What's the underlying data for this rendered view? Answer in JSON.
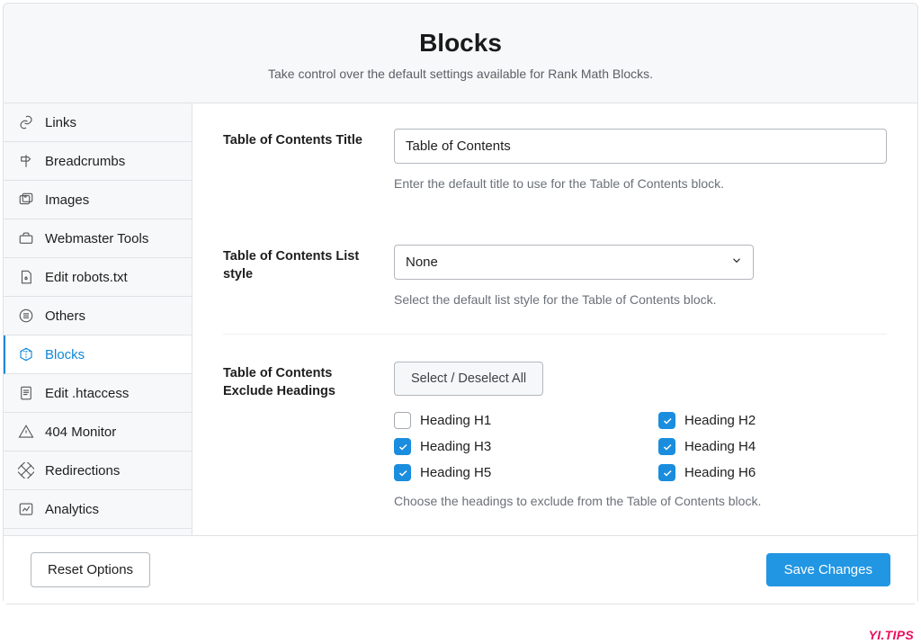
{
  "header": {
    "title": "Blocks",
    "subtitle": "Take control over the default settings available for Rank Math Blocks."
  },
  "sidebar": [
    {
      "label": "Links"
    },
    {
      "label": "Breadcrumbs"
    },
    {
      "label": "Images"
    },
    {
      "label": "Webmaster Tools"
    },
    {
      "label": "Edit robots.txt"
    },
    {
      "label": "Others"
    },
    {
      "label": "Blocks",
      "active": true
    },
    {
      "label": "Edit .htaccess"
    },
    {
      "label": "404 Monitor"
    },
    {
      "label": "Redirections"
    },
    {
      "label": "Analytics"
    }
  ],
  "settings": {
    "toc_title": {
      "label": "Table of Contents Title",
      "value": "Table of Contents",
      "help": "Enter the default title to use for the Table of Contents block."
    },
    "toc_list_style": {
      "label": "Table of Contents List style",
      "value": "None",
      "help": "Select the default list style for the Table of Contents block."
    },
    "toc_exclude": {
      "label": "Table of Contents Exclude Headings",
      "toggle_all": "Select / Deselect All",
      "options": [
        {
          "label": "Heading H1",
          "checked": false
        },
        {
          "label": "Heading H2",
          "checked": true
        },
        {
          "label": "Heading H3",
          "checked": true
        },
        {
          "label": "Heading H4",
          "checked": true
        },
        {
          "label": "Heading H5",
          "checked": true
        },
        {
          "label": "Heading H6",
          "checked": true
        }
      ],
      "help": "Choose the headings to exclude from the Table of Contents block."
    }
  },
  "footer": {
    "reset": "Reset Options",
    "save": "Save Changes"
  },
  "watermark": "YI.TIPS",
  "colors": {
    "accent": "#1a8dde",
    "primary_button": "#2196e3",
    "text": "#1e1e1e",
    "muted": "#6b7078",
    "border": "#e0e2e5"
  }
}
